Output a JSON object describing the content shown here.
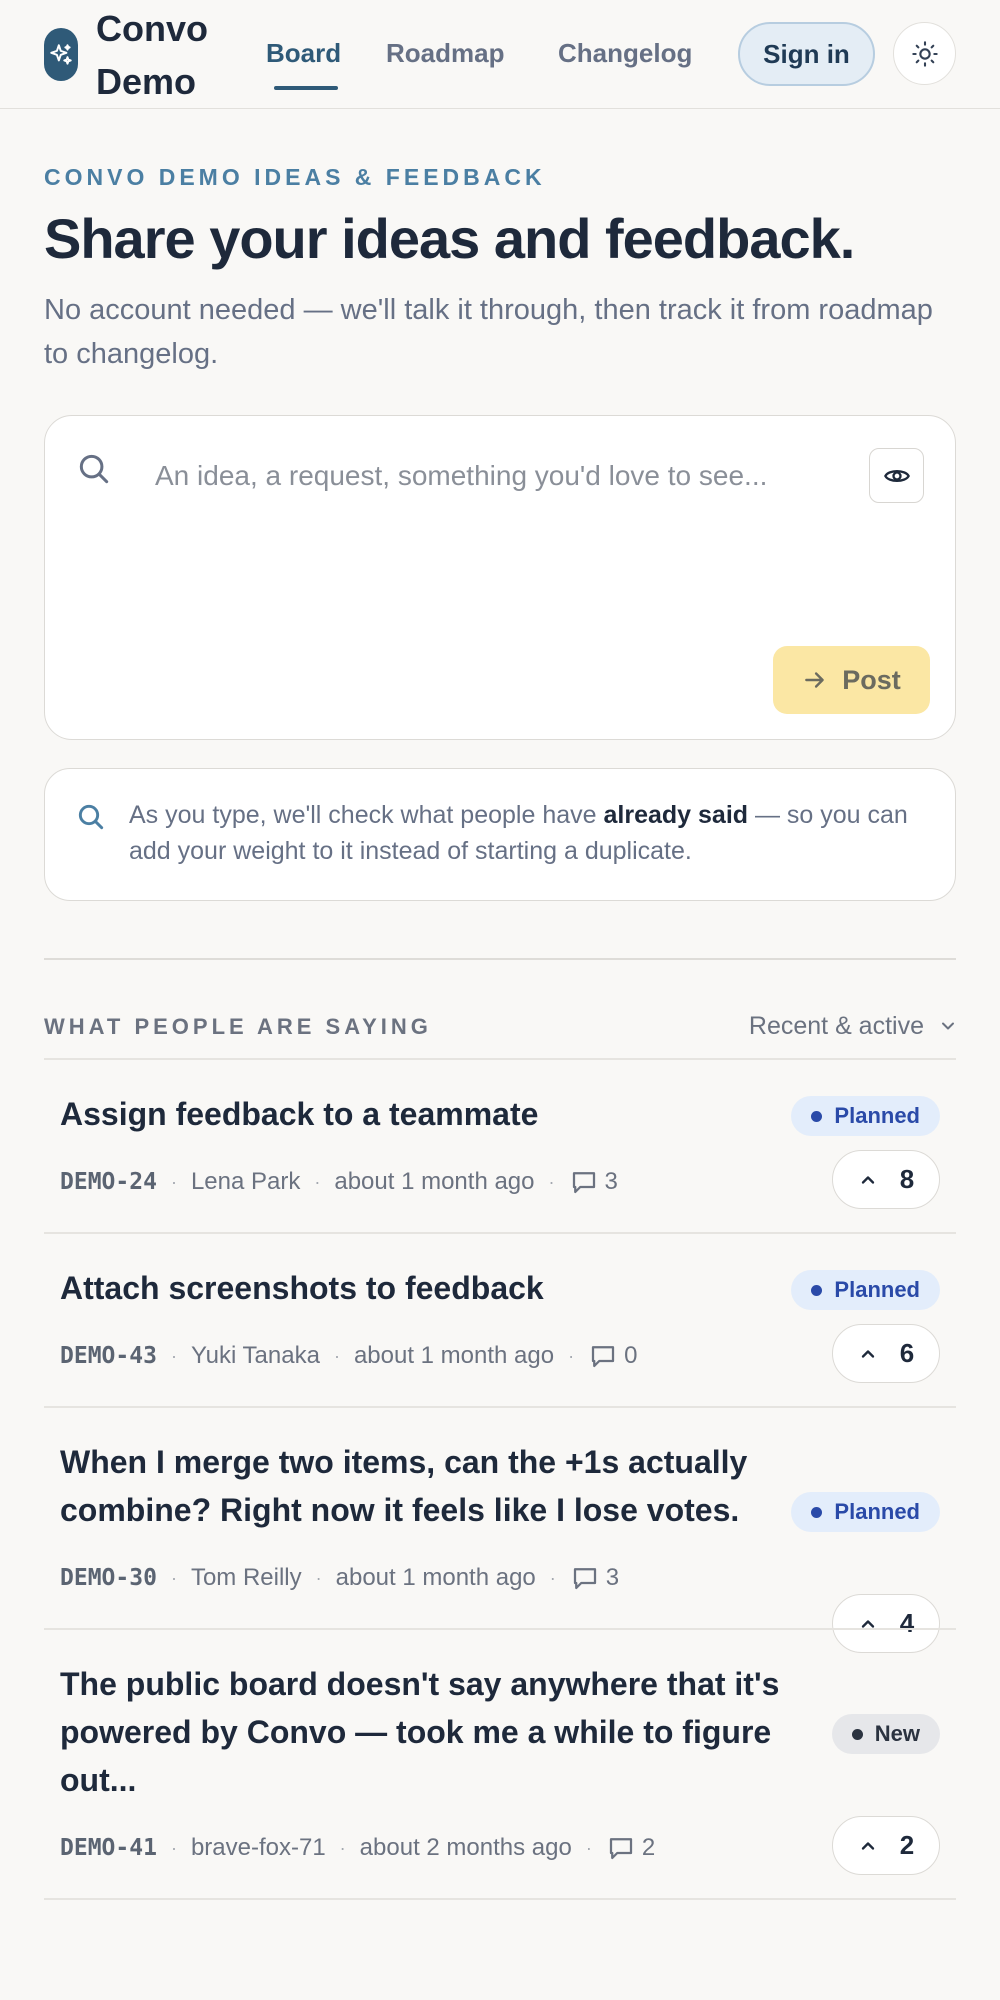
{
  "header": {
    "brand": "Convo Demo",
    "nav": [
      {
        "label": "Board",
        "active": true
      },
      {
        "label": "Roadmap",
        "active": false
      },
      {
        "label": "Changelog",
        "active": false
      }
    ],
    "sign_in": "Sign in",
    "theme_icon": "sun-icon",
    "logo_icon": "sparkle-icon"
  },
  "hero": {
    "eyebrow": "CONVO DEMO IDEAS & FEEDBACK",
    "title": "Share your ideas and feedback.",
    "subtitle": "No account needed — we'll talk it through, then track it from roadmap to changelog."
  },
  "composer": {
    "placeholder": "An idea, a request, something you'd love to see...",
    "value": "",
    "post_label": "Post",
    "preview_icon": "eye-icon",
    "search_icon": "search-icon"
  },
  "hint": {
    "before": "As you type, we'll check what people have ",
    "bold": "already said",
    "after": " — so you can add your weight to it instead of starting a duplicate."
  },
  "feed": {
    "section_label": "WHAT PEOPLE ARE SAYING",
    "sort": "Recent & active",
    "items": [
      {
        "title": "Assign feedback to a teammate",
        "id": "DEMO-24",
        "author": "Lena Park",
        "time": "about 1 month ago",
        "comments": "3",
        "status": "Planned",
        "votes": "8"
      },
      {
        "title": "Attach screenshots to feedback",
        "id": "DEMO-43",
        "author": "Yuki Tanaka",
        "time": "about 1 month ago",
        "comments": "0",
        "status": "Planned",
        "votes": "6"
      },
      {
        "title": "When I merge two items, can the +1s actually combine? Right now it feels like I lose votes.",
        "id": "DEMO-30",
        "author": "Tom Reilly",
        "time": "about 1 month ago",
        "comments": "3",
        "status": "Planned",
        "votes": "4"
      },
      {
        "title": "The public board doesn't say anywhere that it's powered by Convo — took me a while to figure out...",
        "id": "DEMO-41",
        "author": "brave-fox-71",
        "time": "about 2 months ago",
        "comments": "2",
        "status": "New",
        "votes": "2"
      }
    ]
  },
  "colors": {
    "accent": "#2f5a78",
    "planned": "#2a4aa8",
    "post_button": "#fbe7a4",
    "background": "#f9f8f6"
  }
}
